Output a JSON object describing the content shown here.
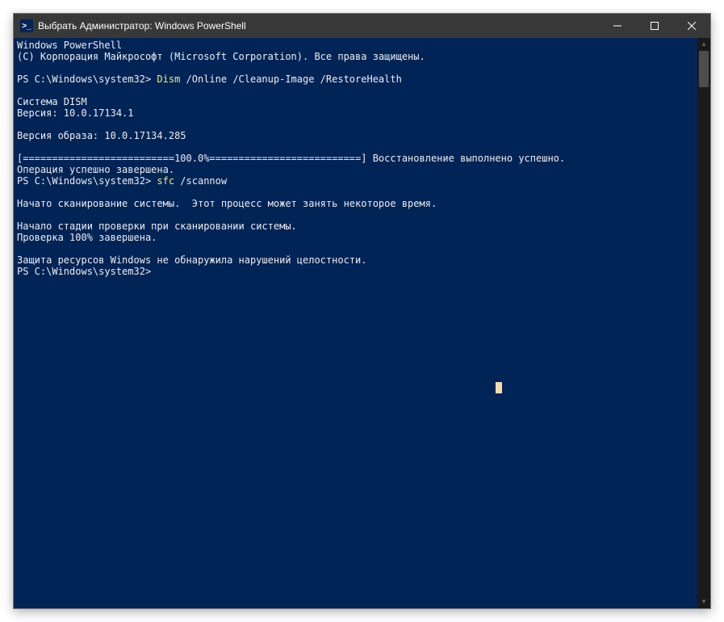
{
  "titlebar": {
    "title": "Выбрать Администратор: Windows PowerShell",
    "icon_text": ">_"
  },
  "terminal": {
    "line1": "Windows PowerShell",
    "line2": "(C) Корпорация Майкрософт (Microsoft Corporation). Все права защищены.",
    "prompt1_path": "PS C:\\Windows\\system32> ",
    "cmd1_yellow": "Dism ",
    "cmd1_rest": "/Online /Cleanup-Image /RestoreHealth",
    "line5": "Cистема DISM",
    "line6": "Версия: 10.0.17134.1",
    "line8": "Версия образа: 10.0.17134.285",
    "line10": "[==========================100.0%==========================] Восстановление выполнено успешно.",
    "line11": "Операция успешно завершена.",
    "prompt2_path": "PS C:\\Windows\\system32> ",
    "cmd2_yellow": "sfc ",
    "cmd2_rest": "/scannow",
    "line14": "Начато сканирование системы.  Этот процесс может занять некоторое время.",
    "line16": "Начало стадии проверки при сканировании системы.",
    "line17": "Проверка 100% завершена.",
    "line19": "Защита ресурсов Windows не обнаружила нарушений целостности.",
    "prompt3_path": "PS C:\\Windows\\system32> "
  }
}
